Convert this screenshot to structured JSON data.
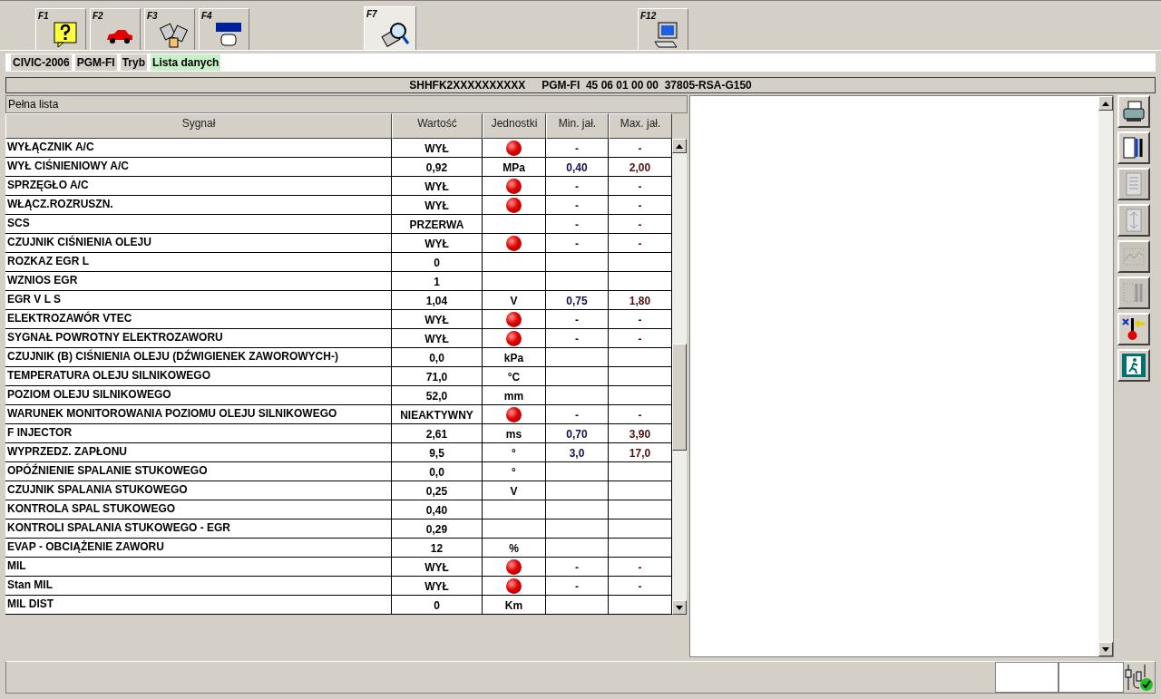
{
  "fkeys": [
    {
      "key": "F1",
      "kind": "help",
      "selected": false
    },
    {
      "key": "F2",
      "kind": "car",
      "selected": false
    },
    {
      "key": "F3",
      "kind": "module",
      "selected": false
    },
    {
      "key": "F4",
      "kind": "tool",
      "selected": false
    },
    {
      "key": "F7",
      "kind": "scan",
      "selected": true
    },
    {
      "key": "F12",
      "kind": "computer",
      "selected": false
    }
  ],
  "breadcrumb": [
    {
      "label": "CIVIC-2006",
      "highlight": false
    },
    {
      "label": "PGM-FI",
      "highlight": false
    },
    {
      "label": "Tryb",
      "highlight": false
    },
    {
      "label": "Lista danych",
      "highlight": true
    }
  ],
  "ecu_header": [
    "SHHFK2XXXXXXXXXX",
    "PGM-FI  45 06 01 00 00  37805-RSA-G150"
  ],
  "list_title": "Pełna lista",
  "table": {
    "columns": [
      "Sygnał",
      "Wartość",
      "Jednostki",
      "Min. jał.",
      "Max. jał."
    ],
    "rows": [
      {
        "signal": "WYŁĄCZNIK A/C",
        "value": "WYŁ",
        "unit": "",
        "led": true,
        "min": "-",
        "max": "-"
      },
      {
        "signal": "WYŁ CIŚNIENIOWY A/C",
        "value": "0,92",
        "unit": "MPa",
        "led": false,
        "min": "0,40",
        "max": "2,00"
      },
      {
        "signal": "SPRZĘGŁO A/C",
        "value": "WYŁ",
        "unit": "",
        "led": true,
        "min": "-",
        "max": "-"
      },
      {
        "signal": "WŁĄCZ.ROZRUSZN.",
        "value": "WYŁ",
        "unit": "",
        "led": true,
        "min": "-",
        "max": "-"
      },
      {
        "signal": "SCS",
        "value": "PRZERWA",
        "unit": "",
        "led": false,
        "min": "-",
        "max": "-"
      },
      {
        "signal": "CZUJNIK CIŚNIENIA OLEJU",
        "value": "WYŁ",
        "unit": "",
        "led": true,
        "min": "-",
        "max": "-"
      },
      {
        "signal": "ROZKAZ EGR L",
        "value": "0",
        "unit": "",
        "led": false,
        "min": "",
        "max": ""
      },
      {
        "signal": "WZNIOS EGR",
        "value": "1",
        "unit": "",
        "led": false,
        "min": "",
        "max": ""
      },
      {
        "signal": "EGR V L S",
        "value": "1,04",
        "unit": "V",
        "led": false,
        "min": "0,75",
        "max": "1,80"
      },
      {
        "signal": "ELEKTROZAWÓR VTEC",
        "value": "WYŁ",
        "unit": "",
        "led": true,
        "min": "-",
        "max": "-"
      },
      {
        "signal": "SYGNAŁ POWROTNY ELEKTROZAWORU",
        "value": "WYŁ",
        "unit": "",
        "led": true,
        "min": "-",
        "max": "-"
      },
      {
        "signal": "CZUJNIK (B) CIŚNIENIA OLEJU (DŹWIGIENEK ZAWOROWYCH-)",
        "value": "0,0",
        "unit": "kPa",
        "led": false,
        "min": "",
        "max": ""
      },
      {
        "signal": "TEMPERATURA OLEJU SILNIKOWEGO",
        "value": "71,0",
        "unit": "°C",
        "led": false,
        "min": "",
        "max": ""
      },
      {
        "signal": "POZIOM OLEJU SILNIKOWEGO",
        "value": "52,0",
        "unit": "mm",
        "led": false,
        "min": "",
        "max": ""
      },
      {
        "signal": "WARUNEK MONITOROWANIA POZIOMU OLEJU SILNIKOWEGO",
        "value": "NIEAKTYWNY",
        "unit": "",
        "led": true,
        "min": "-",
        "max": "-"
      },
      {
        "signal": "F INJECTOR",
        "value": "2,61",
        "unit": "ms",
        "led": false,
        "min": "0,70",
        "max": "3,90"
      },
      {
        "signal": "WYPRZEDZ. ZAPŁONU",
        "value": "9,5",
        "unit": "°",
        "led": false,
        "min": "3,0",
        "max": "17,0"
      },
      {
        "signal": "OPÓŹNIENIE SPALANIE STUKOWEGO",
        "value": "0,0",
        "unit": "°",
        "led": false,
        "min": "",
        "max": ""
      },
      {
        "signal": "CZUJNIK SPALANIA STUKOWEGO",
        "value": "0,25",
        "unit": "V",
        "led": false,
        "min": "",
        "max": ""
      },
      {
        "signal": "KONTROLA SPAL STUKOWEGO",
        "value": "0,40",
        "unit": "",
        "led": false,
        "min": "",
        "max": ""
      },
      {
        "signal": "KONTROLI SPALANIA STUKOWEGO - EGR",
        "value": "0,29",
        "unit": "",
        "led": false,
        "min": "",
        "max": ""
      },
      {
        "signal": "EVAP - OBCIĄŻENIE ZAWORU",
        "value": "12",
        "unit": "%",
        "led": false,
        "min": "",
        "max": ""
      },
      {
        "signal": "MIL",
        "value": "WYŁ",
        "unit": "",
        "led": true,
        "min": "-",
        "max": "-"
      },
      {
        "signal": "Stan MIL",
        "value": "WYŁ",
        "unit": "",
        "led": true,
        "min": "-",
        "max": "-"
      },
      {
        "signal": "MIL DIST",
        "value": "0",
        "unit": "Km",
        "led": false,
        "min": "",
        "max": ""
      }
    ]
  },
  "side_buttons": [
    {
      "kind": "print",
      "disabled": false
    },
    {
      "kind": "settings",
      "disabled": false
    },
    {
      "kind": "list",
      "disabled": true
    },
    {
      "kind": "split",
      "disabled": true
    },
    {
      "kind": "graph",
      "disabled": true
    },
    {
      "kind": "tools",
      "disabled": true
    },
    {
      "kind": "thermo",
      "disabled": false
    },
    {
      "kind": "exit",
      "disabled": false
    }
  ],
  "status": {
    "connected": true
  }
}
